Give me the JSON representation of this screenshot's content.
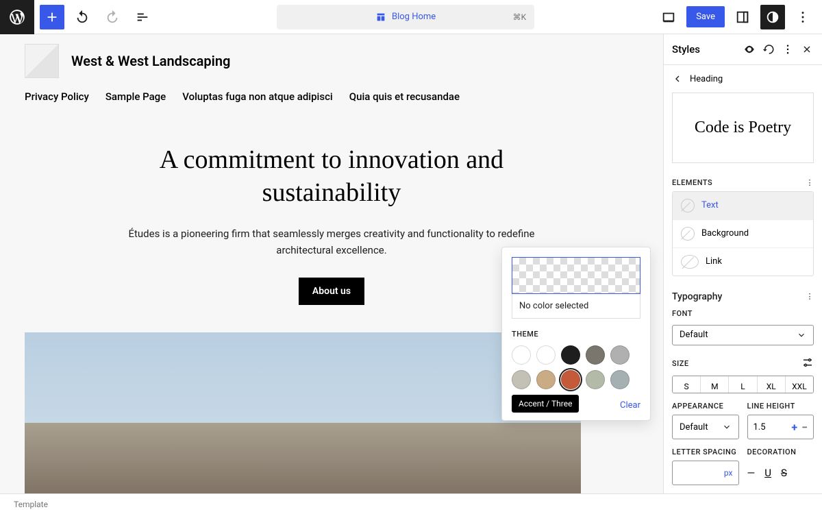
{
  "topbar": {
    "doc_label": "Blog Home",
    "kbd": "⌘K",
    "save": "Save"
  },
  "canvas": {
    "site_title": "West & West Landscaping",
    "nav": [
      "Privacy Policy",
      "Sample Page",
      "Voluptas fuga non atque adipisci",
      "Quia quis et recusandae"
    ],
    "hero_heading": "A commitment to innovation and sustainability",
    "hero_body": "Études is a pioneering firm that seamlessly merges creativity and functionality to redefine architectural excellence.",
    "cta": "About us"
  },
  "popover": {
    "no_color": "No color selected",
    "section": "THEME",
    "swatches": [
      "#ffffff",
      "#ffffff",
      "#1e1e1e",
      "#7b766d",
      "#b0b0b0",
      "#c3c0b6",
      "#c9ab86",
      "#c55a3b",
      "#b4baa8",
      "#a5b0b3"
    ],
    "active_index": 7,
    "tooltip": "Accent / Three",
    "clear": "Clear"
  },
  "inspector": {
    "title": "Styles",
    "crumb": "Heading",
    "preview": "Code is Poetry",
    "elements_label": "ELEMENTS",
    "elements": [
      "Text",
      "Background",
      "Link"
    ],
    "typography_label": "Typography",
    "font_label": "FONT",
    "font_value": "Default",
    "size_label": "SIZE",
    "sizes": [
      "S",
      "M",
      "L",
      "XL",
      "XXL"
    ],
    "appearance_label": "APPEARANCE",
    "appearance_value": "Default",
    "lineheight_label": "LINE HEIGHT",
    "lineheight_value": "1.5",
    "letterspacing_label": "LETTER SPACING",
    "letterspacing_unit": "px",
    "decoration_label": "DECORATION"
  },
  "footer": {
    "template": "Template"
  }
}
